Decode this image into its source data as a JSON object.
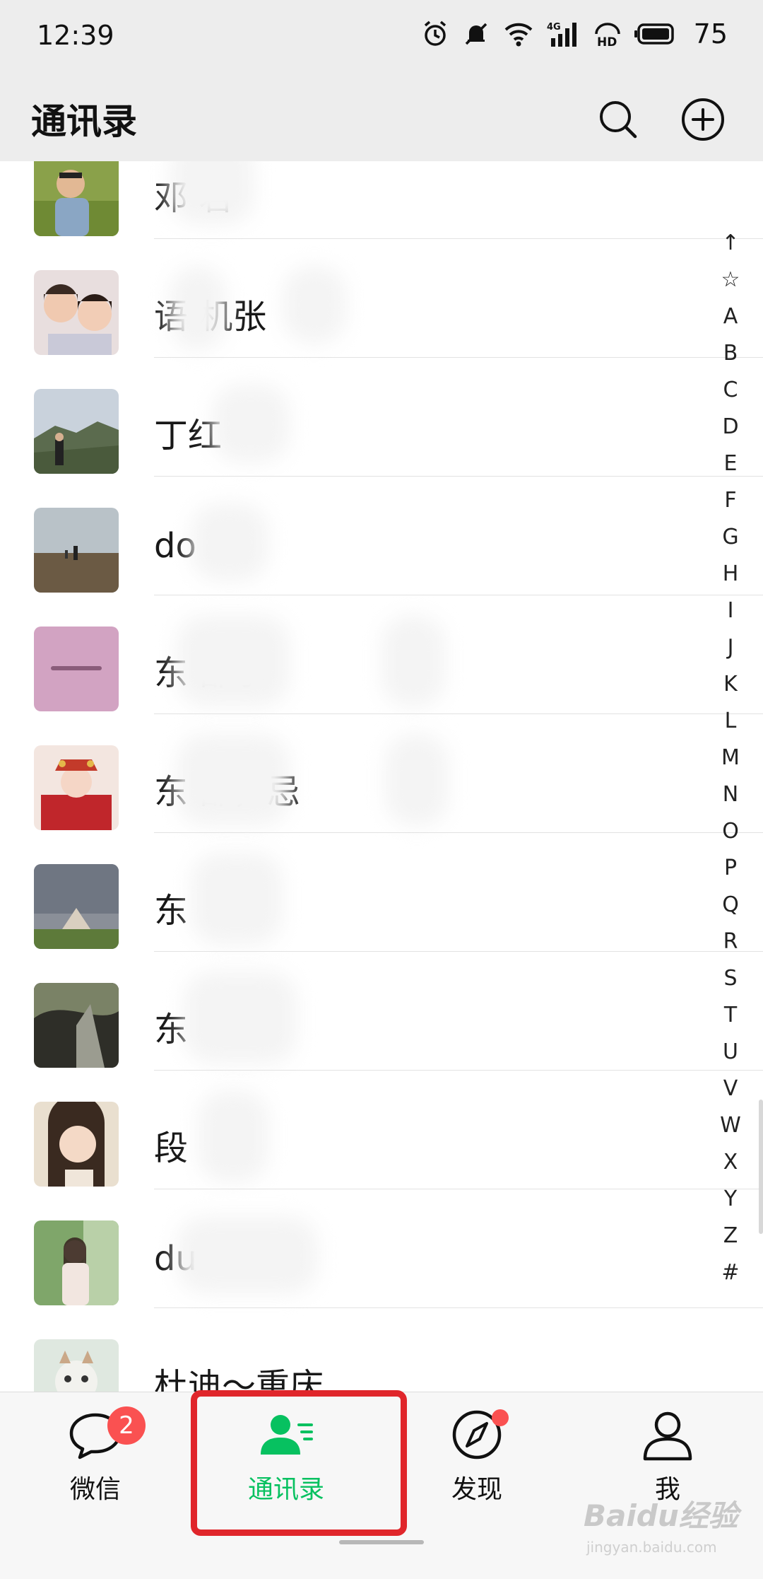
{
  "status_bar": {
    "time": "12:39",
    "battery": "75",
    "network": "4G",
    "hd": "HD"
  },
  "header": {
    "title": "通讯录"
  },
  "contacts": [
    {
      "name": "邓  君"
    },
    {
      "name": "语 机张"
    },
    {
      "name": "丁红"
    },
    {
      "name": "do"
    },
    {
      "name": "东    部李"
    },
    {
      "name": "东    部，忌"
    },
    {
      "name": "东"
    },
    {
      "name": "东"
    },
    {
      "name": "段"
    },
    {
      "name": "du"
    },
    {
      "name": "杜迪～重庆"
    }
  ],
  "index_letters": [
    "↑",
    "☆",
    "A",
    "B",
    "C",
    "D",
    "E",
    "F",
    "G",
    "H",
    "I",
    "J",
    "K",
    "L",
    "M",
    "N",
    "O",
    "P",
    "Q",
    "R",
    "S",
    "T",
    "U",
    "V",
    "W",
    "X",
    "Y",
    "Z",
    "#"
  ],
  "bottom_nav": {
    "chats": {
      "label": "微信",
      "badge": "2"
    },
    "contacts": {
      "label": "通讯录"
    },
    "discover": {
      "label": "发现"
    },
    "me": {
      "label": "我"
    }
  },
  "colors": {
    "accent": "#07c160",
    "badge": "#fa5151",
    "highlight": "#e0262b",
    "header_bg": "#ededed"
  },
  "watermark": {
    "main": "Baidu经验",
    "sub": "jingyan.baidu.com"
  }
}
